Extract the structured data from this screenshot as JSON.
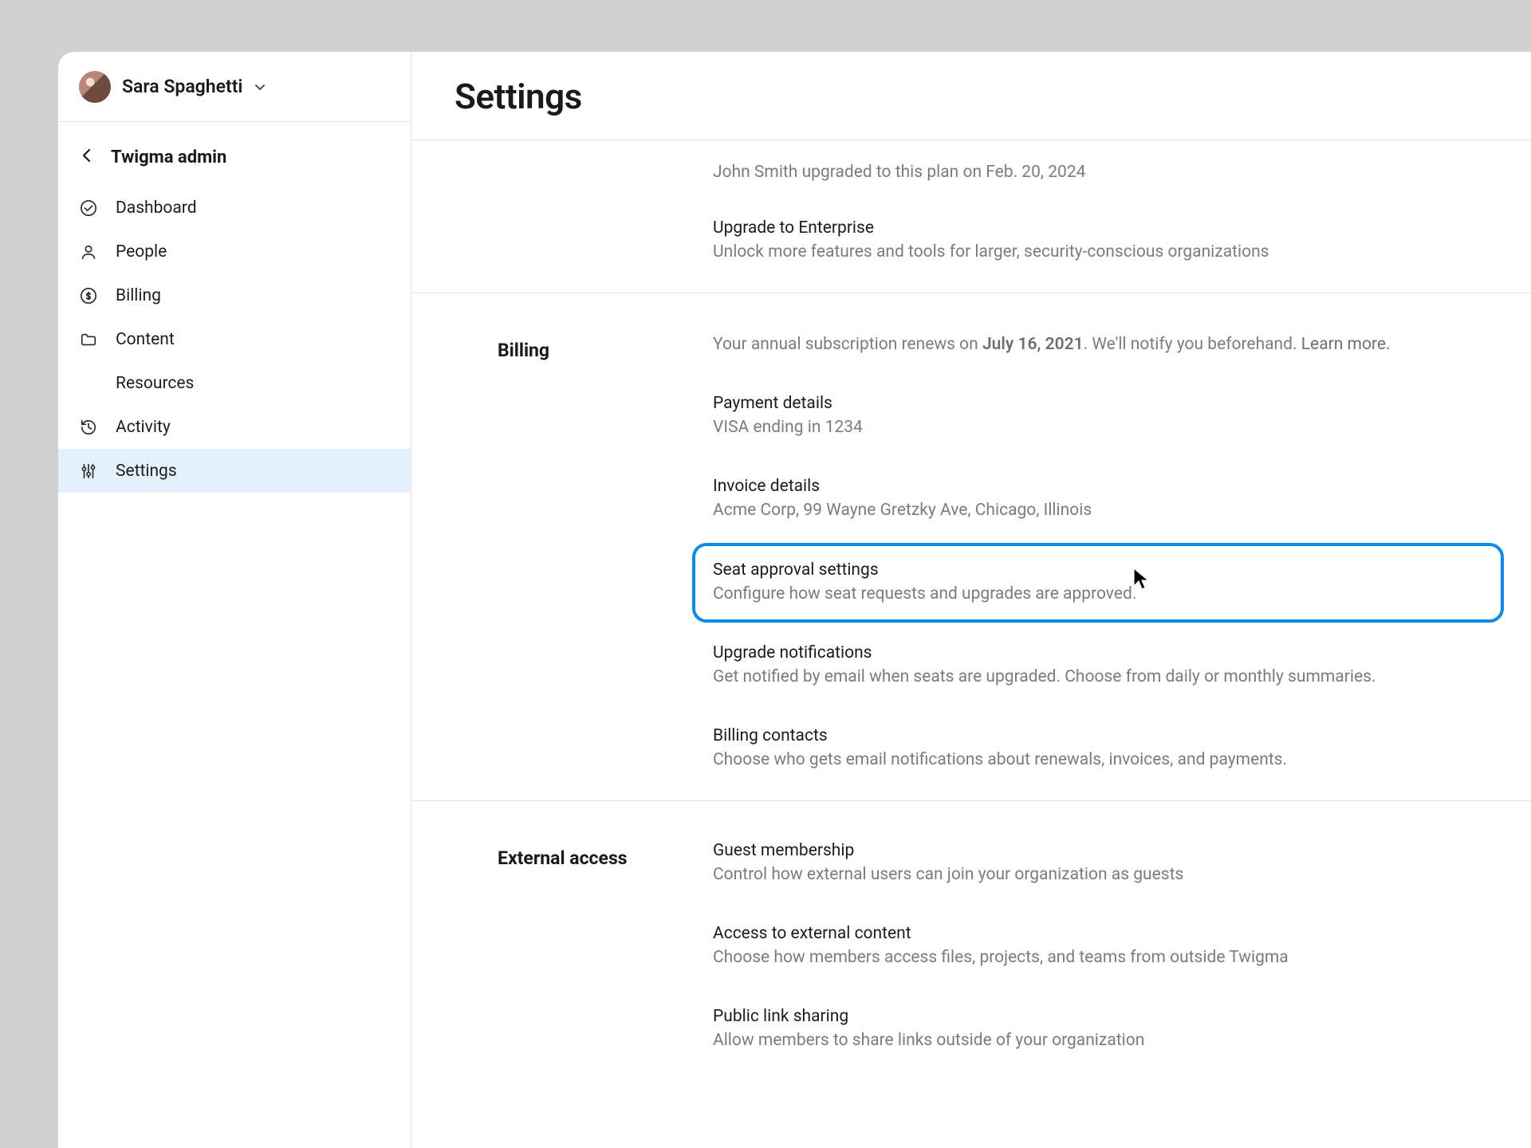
{
  "user": {
    "name": "Sara Spaghetti"
  },
  "sidebar": {
    "back_label": "Twigma admin",
    "items": [
      {
        "label": "Dashboard"
      },
      {
        "label": "People"
      },
      {
        "label": "Billing"
      },
      {
        "label": "Content"
      },
      {
        "label": "Resources"
      },
      {
        "label": "Activity"
      },
      {
        "label": "Settings"
      }
    ]
  },
  "page": {
    "title": "Settings"
  },
  "plan": {
    "upgrade_note": "John Smith upgraded to this plan on Feb. 20, 2024",
    "enterprise_title": "Upgrade to Enterprise",
    "enterprise_desc": "Unlock more features and tools for larger, security-conscious organizations"
  },
  "billing": {
    "section_label": "Billing",
    "renew_prefix": "Your annual subscription renews on ",
    "renew_date": "July 16, 2021",
    "renew_suffix": ". We'll notify you beforehand. ",
    "learn_more": "Learn more.",
    "payment_title": "Payment details",
    "payment_desc": "VISA ending in 1234",
    "invoice_title": "Invoice details",
    "invoice_desc": "Acme Corp, 99 Wayne Gretzky Ave, Chicago, Illinois",
    "seat_title": "Seat approval settings",
    "seat_desc": "Configure how seat requests and upgrades are approved.",
    "notify_title": "Upgrade notifications",
    "notify_desc": "Get notified by email when seats are upgraded. Choose from daily or monthly summaries.",
    "contacts_title": "Billing contacts",
    "contacts_desc": "Choose who gets email notifications about renewals, invoices, and payments."
  },
  "external": {
    "section_label": "External access",
    "guest_title": "Guest membership",
    "guest_desc": "Control how external users can join your organization as guests",
    "content_title": "Access to external content",
    "content_desc": "Choose how members access files, projects, and teams from outside Twigma",
    "link_title": "Public link sharing",
    "link_desc": "Allow members to share links outside of your organization"
  }
}
